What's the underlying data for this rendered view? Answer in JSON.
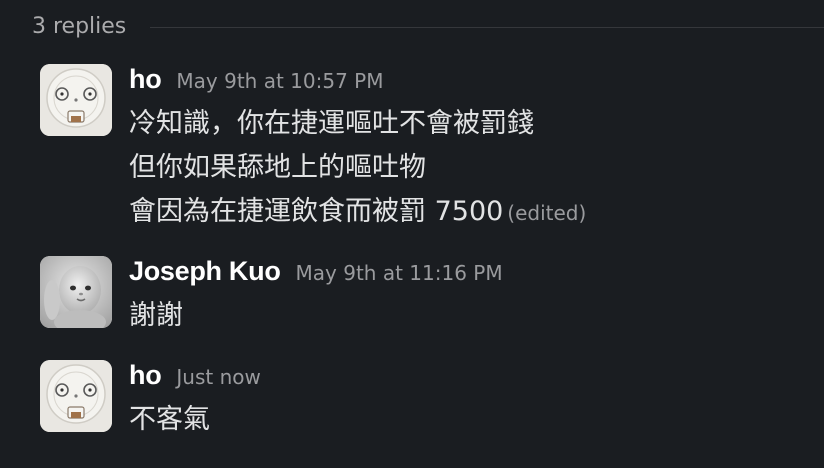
{
  "thread": {
    "replies_label": "3 replies"
  },
  "messages": [
    {
      "sender": "ho",
      "timestamp": "May 9th at 10:57 PM",
      "avatar_icon": "coffee-cup-lid-face-icon",
      "lines": [
        "冷知識，你在捷運嘔吐不會被罰錢",
        "但你如果舔地上的嘔吐物",
        "會因為在捷運飲食而被罰 7500"
      ],
      "edited_label": "(edited)"
    },
    {
      "sender": "Joseph Kuo",
      "timestamp": "May 9th at 11:16 PM",
      "avatar_icon": "baby-photo-icon",
      "lines": [
        "謝謝"
      ]
    },
    {
      "sender": "ho",
      "timestamp": "Just now",
      "avatar_icon": "coffee-cup-lid-face-icon",
      "lines": [
        "不客氣"
      ]
    }
  ],
  "colors": {
    "background": "#1a1d21",
    "sender": "#ffffff",
    "text": "#e2e3e4",
    "muted": "#9a9b9e"
  }
}
